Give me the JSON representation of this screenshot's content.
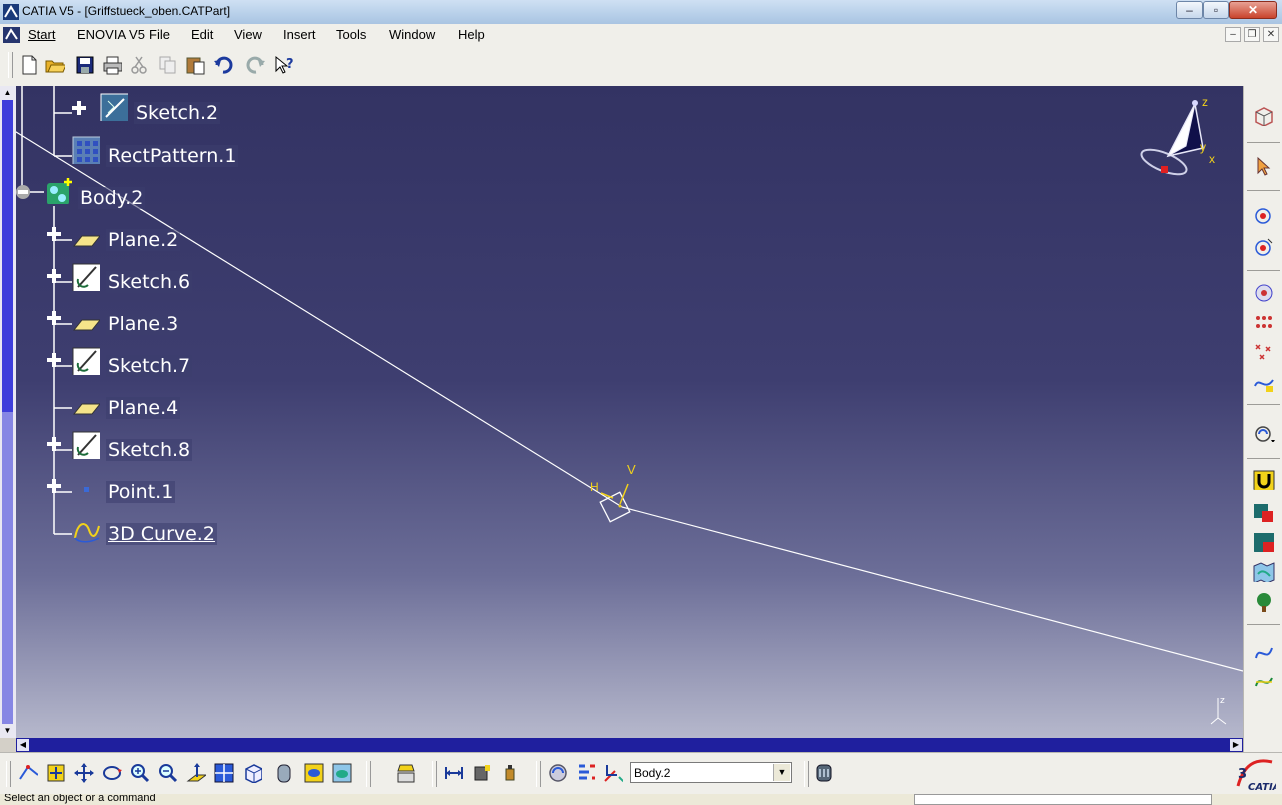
{
  "window": {
    "title": "CATIA V5 - [Griffstueck_oben.CATPart]"
  },
  "menu": {
    "items": [
      "Start",
      "ENOVIA V5",
      "File",
      "Edit",
      "View",
      "Insert",
      "Tools",
      "Window",
      "Help"
    ]
  },
  "tree": {
    "nodes": [
      {
        "label": "Sketch.2",
        "icon": "sketch-icon"
      },
      {
        "label": "RectPattern.1",
        "icon": "rect-pattern-icon"
      },
      {
        "label": "Body.2",
        "icon": "body-icon"
      },
      {
        "label": "Plane.2",
        "icon": "plane-icon"
      },
      {
        "label": "Sketch.6",
        "icon": "sketch-icon"
      },
      {
        "label": "Plane.3",
        "icon": "plane-icon"
      },
      {
        "label": "Sketch.7",
        "icon": "sketch-icon"
      },
      {
        "label": "Plane.4",
        "icon": "plane-icon"
      },
      {
        "label": "Sketch.8",
        "icon": "sketch-icon"
      },
      {
        "label": "Point.1",
        "icon": "point-icon"
      },
      {
        "label": "3D Curve.2",
        "icon": "curve-icon"
      }
    ]
  },
  "axis": {
    "h": "H",
    "v": "V"
  },
  "compass": {
    "z": "z",
    "x": "x",
    "y": "y"
  },
  "bottom_toolbar": {
    "current_body": "Body.2"
  },
  "status": {
    "message": "Select an object or a command"
  },
  "colors": {
    "viewport_top": "#333363",
    "viewport_bottom": "#b6b8cc",
    "curve": "#ffffff",
    "axis": "#ffff00"
  }
}
